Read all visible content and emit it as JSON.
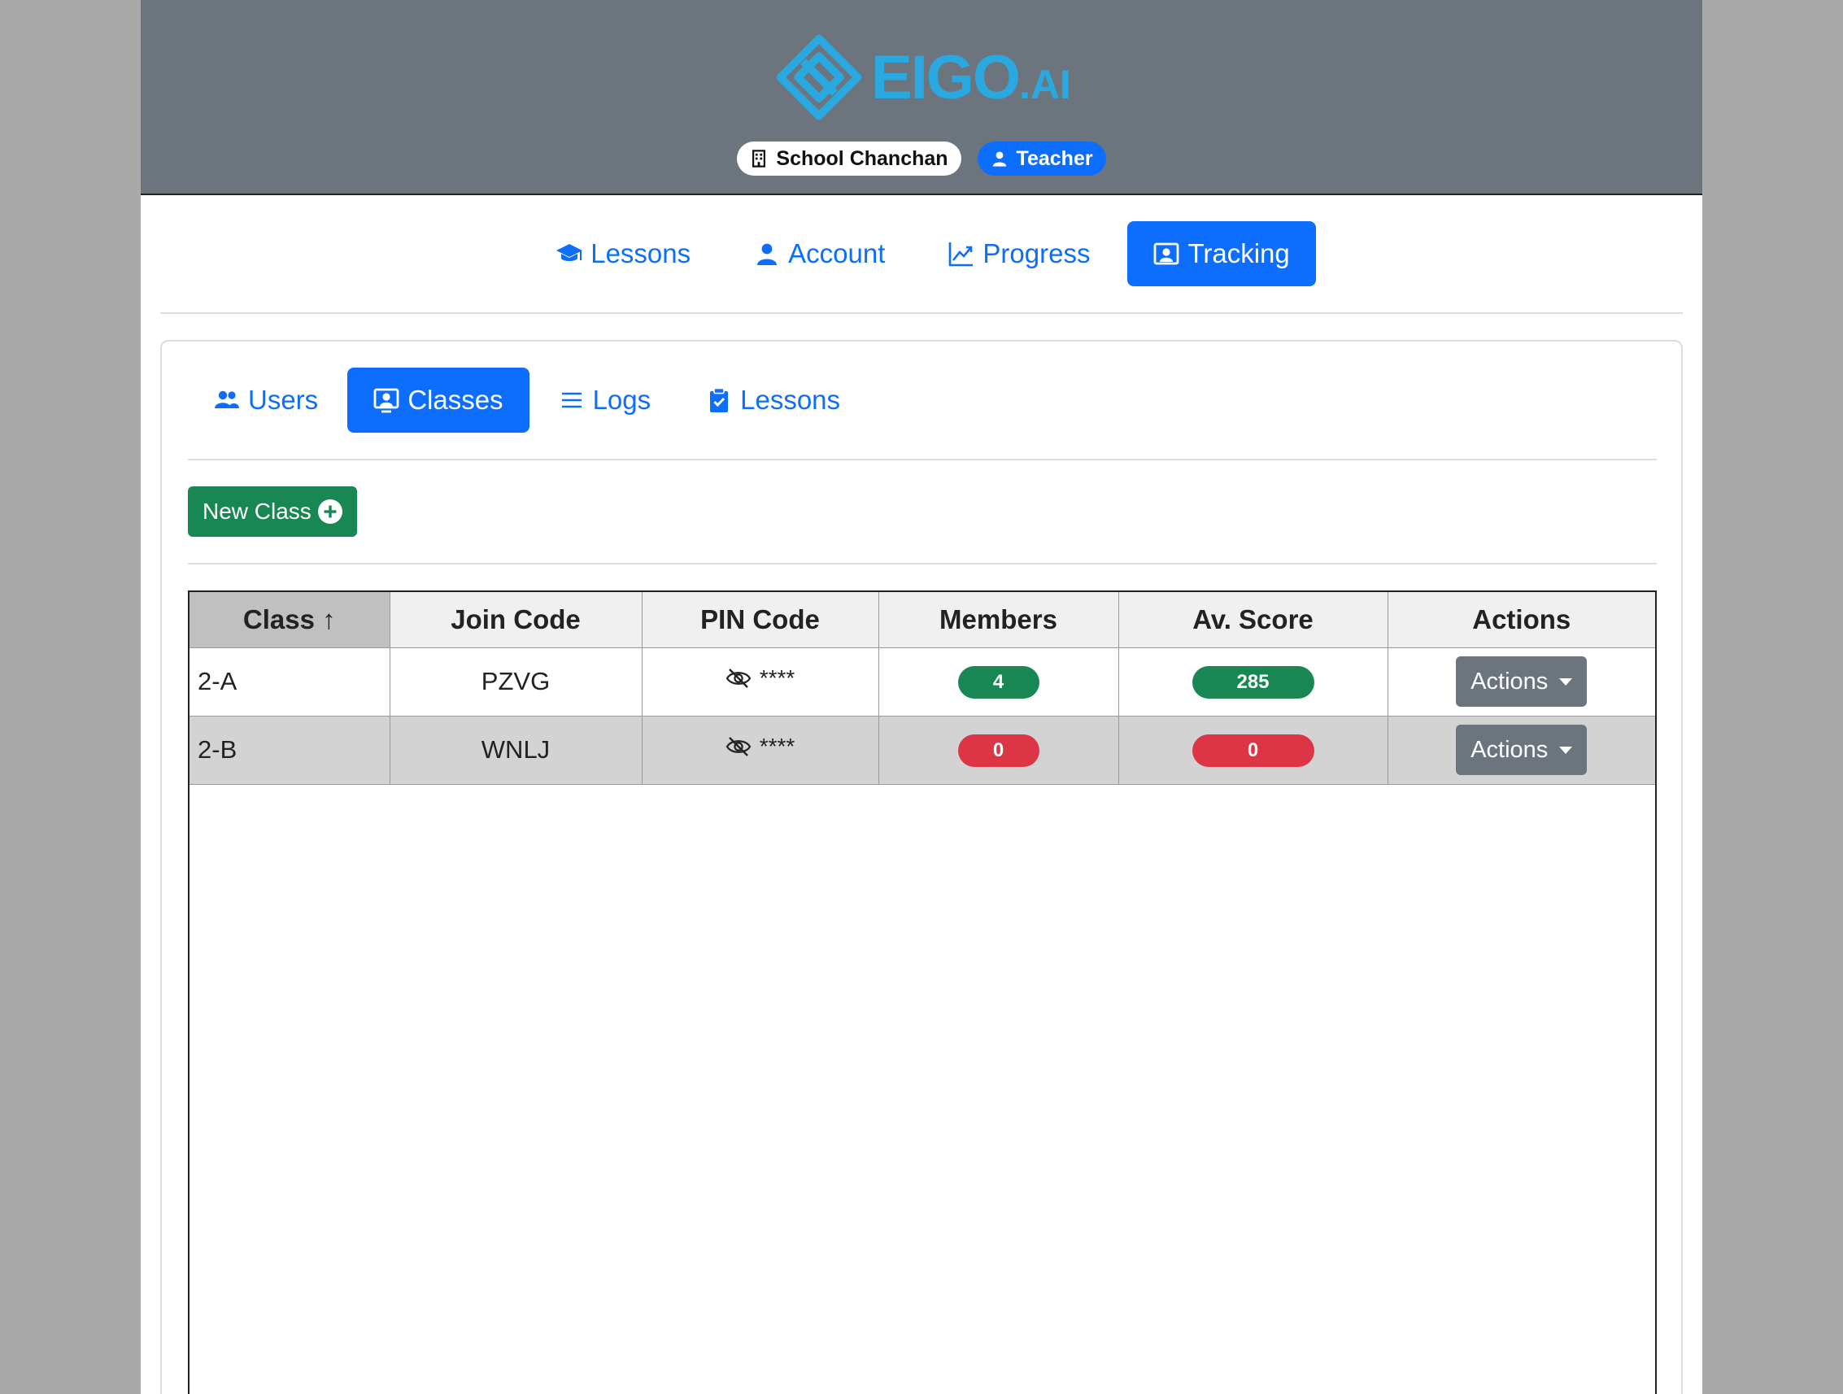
{
  "header": {
    "logo_text": "EIGO",
    "logo_suffix": ".AI",
    "school_label": "School Chanchan",
    "role_label": "Teacher"
  },
  "topnav": {
    "items": [
      {
        "label": "Lessons",
        "icon": "graduation-cap-icon"
      },
      {
        "label": "Account",
        "icon": "person-icon"
      },
      {
        "label": "Progress",
        "icon": "chart-line-icon"
      },
      {
        "label": "Tracking",
        "icon": "person-badge-icon",
        "active": true
      }
    ]
  },
  "subnav": {
    "items": [
      {
        "label": "Users",
        "icon": "people-icon"
      },
      {
        "label": "Classes",
        "icon": "person-badge-icon",
        "active": true
      },
      {
        "label": "Logs",
        "icon": "list-icon"
      },
      {
        "label": "Lessons",
        "icon": "clipboard-check-icon"
      }
    ]
  },
  "new_class_label": "New Class",
  "table": {
    "columns": [
      "Class",
      "Join Code",
      "PIN Code",
      "Members",
      "Av. Score",
      "Actions"
    ],
    "sort_indicator": "↑",
    "rows": [
      {
        "class": "2-A",
        "join_code": "PZVG",
        "pin": "****",
        "members": "4",
        "members_status": "success",
        "score": "285",
        "score_status": "success",
        "action_label": "Actions"
      },
      {
        "class": "2-B",
        "join_code": "WNLJ",
        "pin": "****",
        "members": "0",
        "members_status": "danger",
        "score": "0",
        "score_status": "danger",
        "action_label": "Actions"
      }
    ]
  },
  "colors": {
    "primary": "#0d6efd",
    "success": "#198754",
    "danger": "#dc3545",
    "header_bg": "#6c757d",
    "logo": "#2aa8e0"
  }
}
